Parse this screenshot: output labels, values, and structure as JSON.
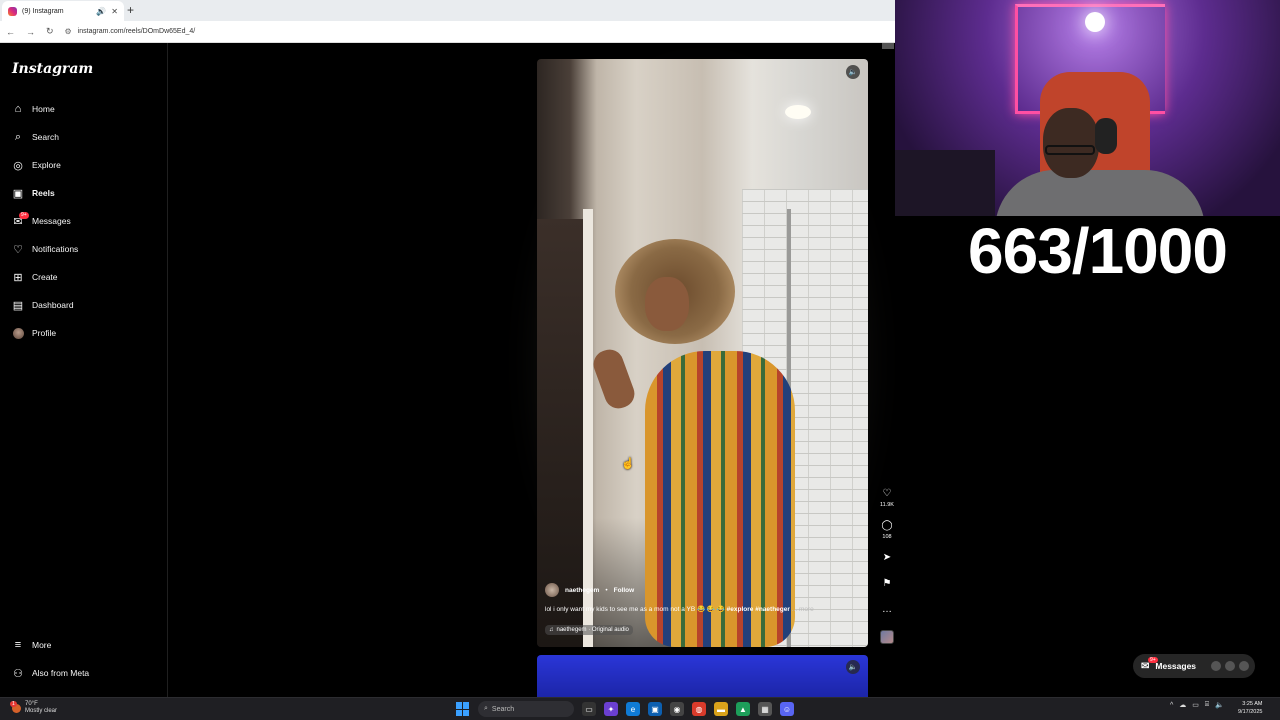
{
  "browser": {
    "tab_title": "(9) Instagram",
    "new_tab_icon": "+",
    "url": "instagram.com/reels/DOmDw65Ed_4/"
  },
  "instagram": {
    "logo": "Instagram",
    "nav": [
      {
        "label": "Home",
        "icon": "home-icon",
        "glyph": "⌂"
      },
      {
        "label": "Search",
        "icon": "search-icon",
        "glyph": "⌕"
      },
      {
        "label": "Explore",
        "icon": "compass-icon",
        "glyph": "◎"
      },
      {
        "label": "Reels",
        "icon": "reels-icon",
        "glyph": "▣"
      },
      {
        "label": "Messages",
        "icon": "messenger-icon",
        "glyph": "✉",
        "badge": "9+"
      },
      {
        "label": "Notifications",
        "icon": "heart-icon",
        "glyph": "♡"
      },
      {
        "label": "Create",
        "icon": "plus-square-icon",
        "glyph": "⊞"
      },
      {
        "label": "Dashboard",
        "icon": "dashboard-icon",
        "glyph": "▤"
      },
      {
        "label": "Profile",
        "icon": "avatar",
        "glyph": ""
      }
    ],
    "bottom_nav": [
      {
        "label": "More",
        "icon": "menu-icon",
        "glyph": "≡"
      },
      {
        "label": "Also from Meta",
        "icon": "meta-icon",
        "glyph": "⚇"
      }
    ],
    "reel": {
      "username": "naethegem",
      "separator": "•",
      "follow": "Follow",
      "caption_text": "lol i only want my kids to see me as a mom not a YB 😂 😂 😂 ",
      "caption_tags": "#explore #naetheger",
      "caption_more": "... more",
      "audio": "naethegem · Original audio",
      "likes": "11.9K",
      "comments": "108"
    }
  },
  "overlay": {
    "counter": "663/1000"
  },
  "messages_pill": {
    "label": "Messages",
    "badge": "9+"
  },
  "taskbar": {
    "temperature": "70°F",
    "weather": "Mostly clear",
    "weather_badge": "1",
    "search_placeholder": "Search",
    "time": "3:25 AM",
    "date": "9/17/2025"
  }
}
